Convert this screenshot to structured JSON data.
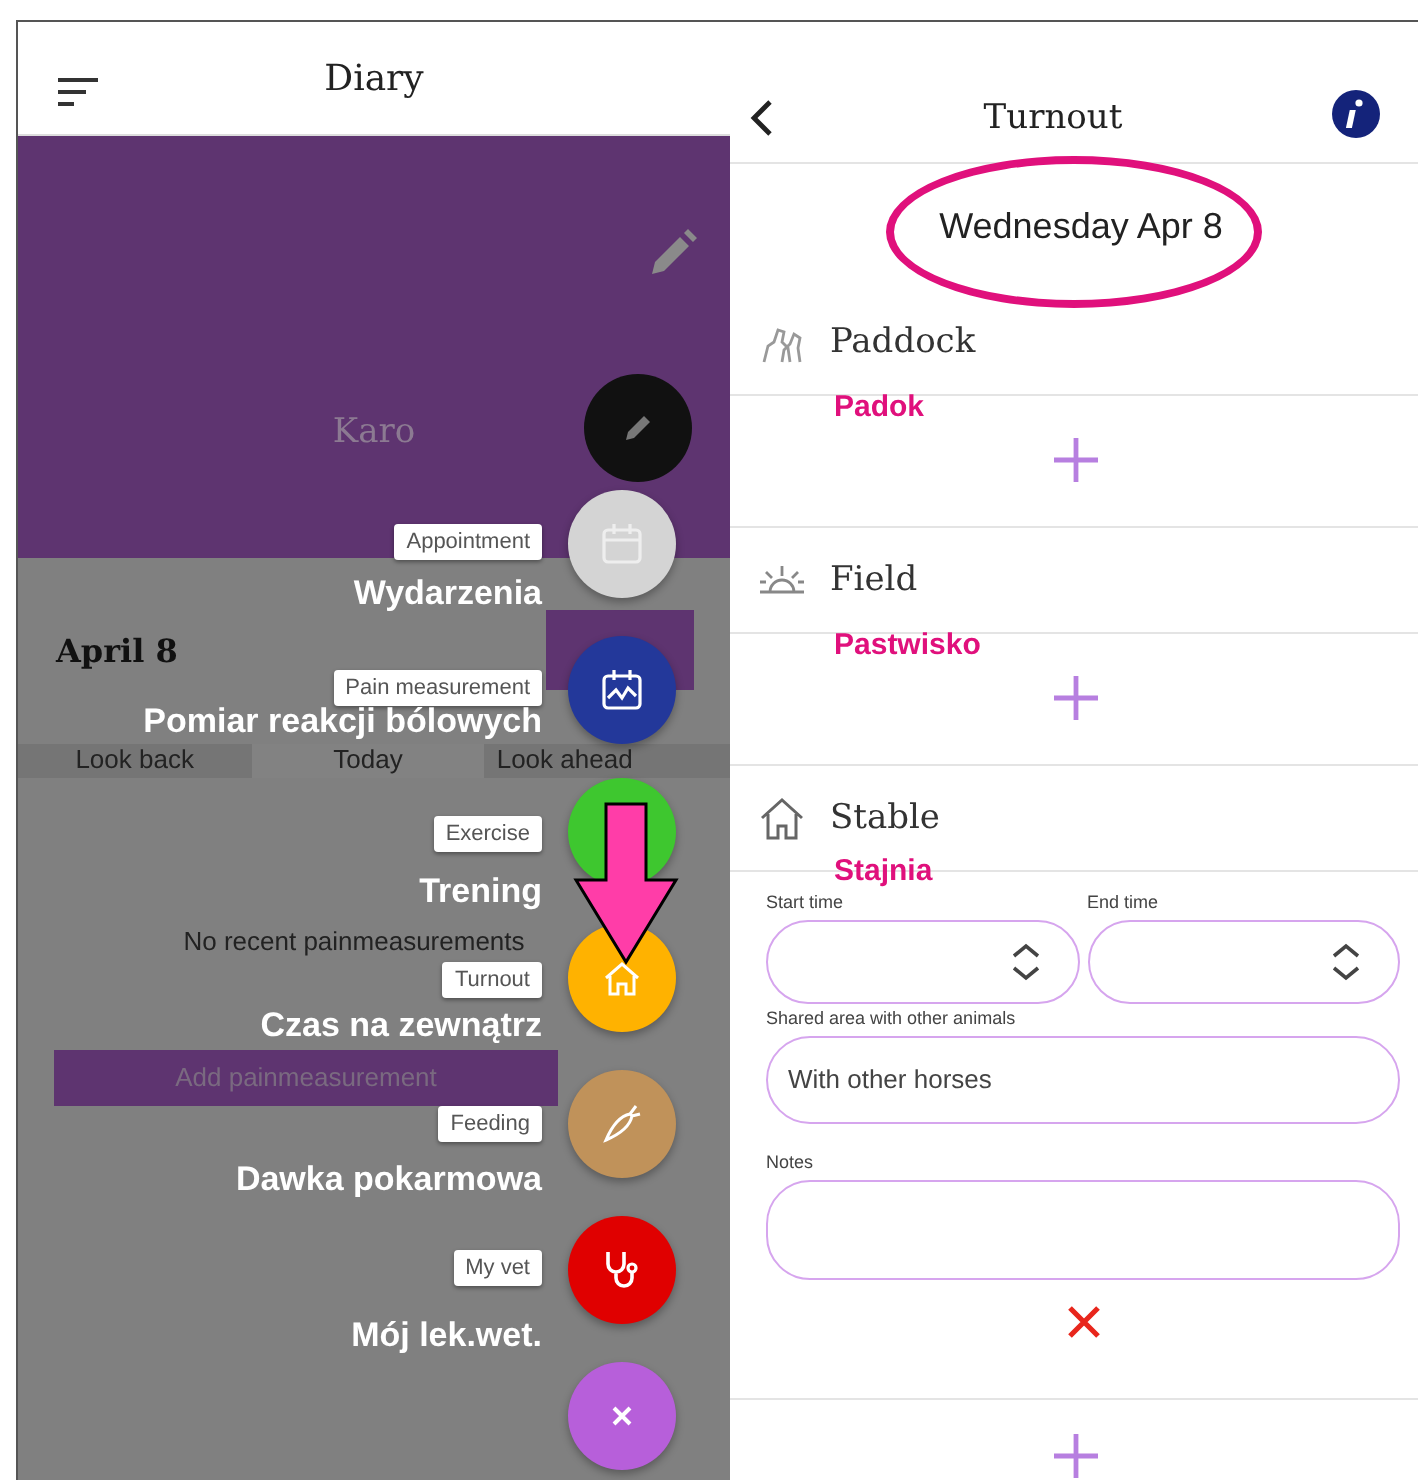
{
  "diary": {
    "title": "Diary",
    "horse_name": "Karo",
    "date": "April 8",
    "tabs": [
      {
        "label": "Look back",
        "selected": false
      },
      {
        "label": "Today",
        "selected": true
      },
      {
        "label": "Look ahead",
        "selected": false
      }
    ],
    "empty_message": "No recent painmeasurements",
    "add_button": "Add painmeasurement",
    "fab_menu": [
      {
        "label": "Appointment",
        "translation": "Wydarzenia",
        "color": "#d4d4d4"
      },
      {
        "label": "Pain measurement",
        "translation": "Pomiar reakcji bólowych",
        "color": "#23389a"
      },
      {
        "label": "Exercise",
        "translation": "Trening",
        "color": "#3ec72f"
      },
      {
        "label": "Turnout",
        "translation": "Czas na zewnątrz",
        "color": "#ffb200"
      },
      {
        "label": "Feeding",
        "translation": "Dawka pokarmowa",
        "color": "#c0925a"
      },
      {
        "label": "My vet",
        "translation": "Mój lek.wet.",
        "color": "#e00000"
      }
    ]
  },
  "turnout": {
    "title": "Turnout",
    "date": "Wednesday Apr 8",
    "sections": [
      {
        "kind": "add",
        "name": "Paddock",
        "translation": "Padok"
      },
      {
        "kind": "add",
        "name": "Field",
        "translation": "Pastwisko"
      },
      {
        "kind": "form",
        "name": "Stable",
        "translation": "Stajnia",
        "start_time_label": "Start time",
        "end_time_label": "End time",
        "shared_area_label": "Shared area with other animals",
        "shared_area_value": "With other horses",
        "notes_label": "Notes"
      }
    ]
  }
}
